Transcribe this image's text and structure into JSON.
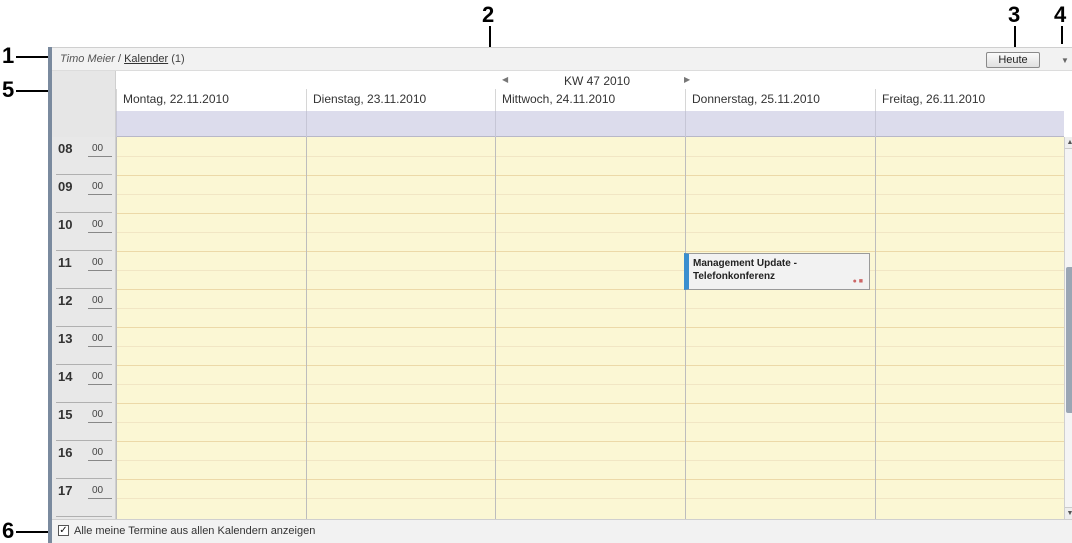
{
  "callouts": [
    "1",
    "2",
    "3",
    "4",
    "5",
    "6"
  ],
  "header": {
    "user": "Timo Meier",
    "separator": " / ",
    "calendar_link": "Kalender",
    "count": " (1)",
    "today_label": "Heute",
    "menu_icon": "chevron-down-icon"
  },
  "week_nav": {
    "label": "KW 47 2010",
    "prev_icon": "caret-left-icon",
    "next_icon": "caret-right-icon"
  },
  "days": [
    "Montag, 22.11.2010",
    "Dienstag, 23.11.2010",
    "Mittwoch, 24.11.2010",
    "Donnerstag, 25.11.2010",
    "Freitag, 26.11.2010"
  ],
  "hours": [
    {
      "hour": "08",
      "minute": "00"
    },
    {
      "hour": "09",
      "minute": "00"
    },
    {
      "hour": "10",
      "minute": "00"
    },
    {
      "hour": "11",
      "minute": "00"
    },
    {
      "hour": "12",
      "minute": "00"
    },
    {
      "hour": "13",
      "minute": "00"
    },
    {
      "hour": "14",
      "minute": "00"
    },
    {
      "hour": "15",
      "minute": "00"
    },
    {
      "hour": "16",
      "minute": "00"
    },
    {
      "hour": "17",
      "minute": "00"
    }
  ],
  "event": {
    "title_line1": "Management Update -",
    "title_line2": "Telefonkonferenz",
    "day": "Donnerstag, 25.11.2010",
    "color": "#3a8fcf"
  },
  "footer": {
    "checkbox_checked": true,
    "checkbox_label": "Alle meine Termine aus allen Kalendern anzeigen"
  },
  "colors": {
    "grid_background": "#fbf7d4",
    "allday_background": "#dcdcec",
    "frame_accent": "#7a8a9e"
  }
}
